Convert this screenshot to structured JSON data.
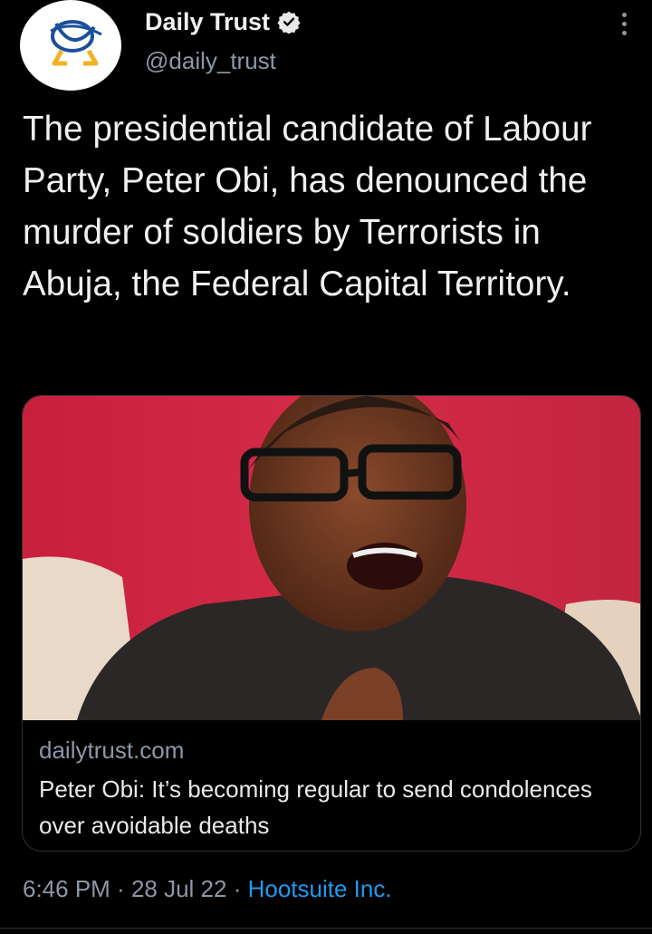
{
  "account": {
    "name": "Daily Trust",
    "handle": "@daily_trust",
    "verified_icon": "verified-badge-icon",
    "more_icon": "more-vertical-icon"
  },
  "tweet": {
    "text": "The presidential candidate of Labour Party, Peter Obi, has denounced the murder of soldiers by Terrorists in Abuja, the Federal Capital Territory."
  },
  "link_card": {
    "domain": "dailytrust.com",
    "title": "Peter Obi: It’s becoming regular to send condolences over avoidable deaths",
    "image": "photo-of-man-in-glasses-speaking"
  },
  "meta": {
    "time": "6:46 PM",
    "sep1": " · ",
    "date": "28 Jul 22",
    "sep2": " · ",
    "source": "Hootsuite Inc."
  },
  "colors": {
    "background": "#000000",
    "text": "#e7e9ea",
    "secondary": "#8b98a5",
    "link": "#1d9bf0",
    "border": "#2f3336",
    "logo_blue": "#1a4f9c",
    "logo_yellow": "#f0b323"
  }
}
